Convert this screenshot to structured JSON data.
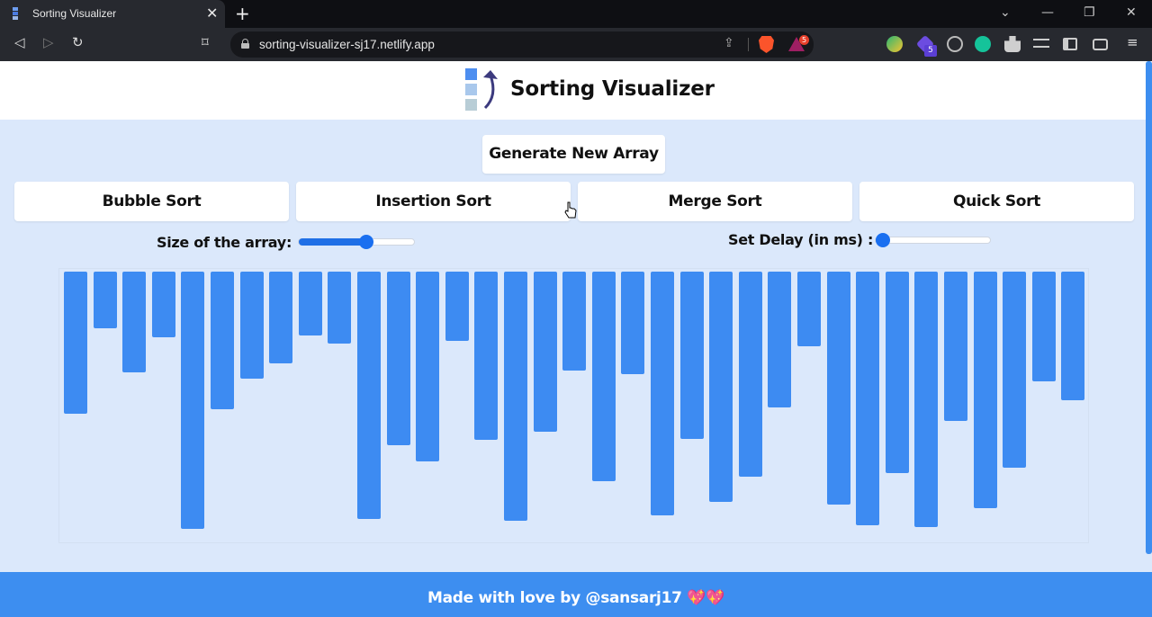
{
  "browser": {
    "tab_title": "Sorting Visualizer",
    "tab_close": "✕",
    "new_tab": "+",
    "url": "sorting-visualizer-sj17.netlify.app",
    "rewards_badge": "5",
    "extension_badge": "5",
    "back": "◁",
    "forward": "▷",
    "reload": "↻",
    "bookmark": "⌑",
    "share": "⇪",
    "win_minimize": "—",
    "win_restore": "❐",
    "win_close": "✕",
    "tab_dropdown": "⌄"
  },
  "header": {
    "title": "Sorting Visualizer"
  },
  "controls": {
    "generate_label": "Generate New Array",
    "algorithms": [
      "Bubble Sort",
      "Insertion Sort",
      "Merge Sort",
      "Quick Sort"
    ],
    "size_label": "Size of the array:",
    "size_value_fraction": 0.6,
    "delay_label": "Set Delay (in ms) :",
    "delay_value_fraction": 0.0
  },
  "array_bars": [
    158,
    63,
    112,
    73,
    286,
    153,
    119,
    102,
    71,
    80,
    275,
    193,
    211,
    77,
    187,
    277,
    178,
    110,
    233,
    114,
    271,
    186,
    256,
    228,
    151,
    83,
    259,
    282,
    224,
    284,
    166,
    263,
    218,
    122,
    143
  ],
  "footer": {
    "text": "Made with love by @sansarj17 💖💖"
  },
  "colors": {
    "accent": "#3d8bf2",
    "page_bg": "#dbe8fb",
    "footer_bg": "#3d8ef0"
  }
}
